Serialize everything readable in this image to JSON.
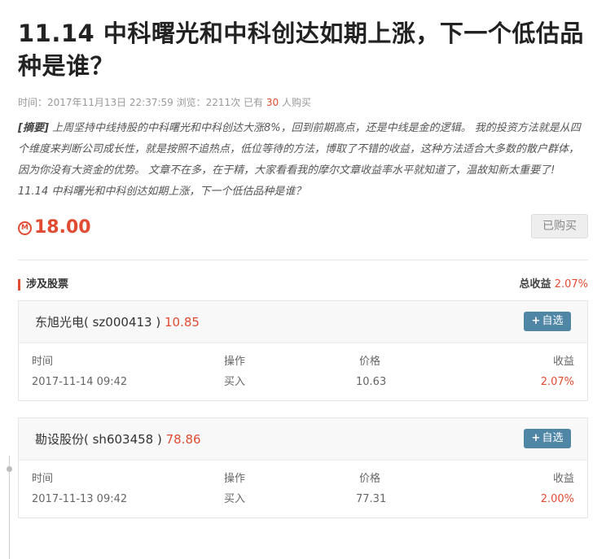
{
  "article": {
    "title": "11.14 中科曙光和中科创达如期上涨，下一个低估品种是谁？",
    "meta": {
      "time_label": "时间：",
      "time_value": "2017年11月13日 22:37:59",
      "views_label": "浏览：",
      "views_value": "2211次",
      "buyers_prefix": "已有",
      "buyers_count": "30",
      "buyers_suffix": "人购买"
    },
    "summary_tag": "[摘要]",
    "summary_text": " 上周坚持中线持股的中科曙光和中科创达大涨8%，回到前期高点，还是中线是金的逻辑。 我的投资方法就是从四个维度来判断公司成长性，就是按照不追热点，低位等待的方法，博取了不错的收益，这种方法适合大多数的散户群体，因为你没有大资金的优势。 文章不在多，在于精，大家看看我的摩尔文章收益率水平就知道了，温故知新太重要了! 11.14 中科曙光和中科创达如期上涨，下一个低估品种是谁？",
    "price_icon": "M",
    "price": "18.00",
    "bought_label": "已购买"
  },
  "section": {
    "title": "涉及股票",
    "total_label": "总收益",
    "total_value": "2.07%"
  },
  "table_headers": {
    "time": "时间",
    "op": "操作",
    "price": "价格",
    "profit": "收益"
  },
  "stocks": [
    {
      "name": "东旭光电( sz000413 )",
      "current_price": "10.85",
      "fav_label": "自选",
      "trade": {
        "time": "2017-11-14 09:42",
        "op": "买入",
        "price": "10.63",
        "profit": "2.07%"
      }
    },
    {
      "name": "勘设股份( sh603458 )",
      "current_price": "78.86",
      "fav_label": "自选",
      "trade": {
        "time": "2017-11-13 09:42",
        "op": "买入",
        "price": "77.31",
        "profit": "2.00%"
      }
    }
  ],
  "colors": {
    "accent_red": "#e04b32",
    "button_blue": "#4f86a6"
  }
}
